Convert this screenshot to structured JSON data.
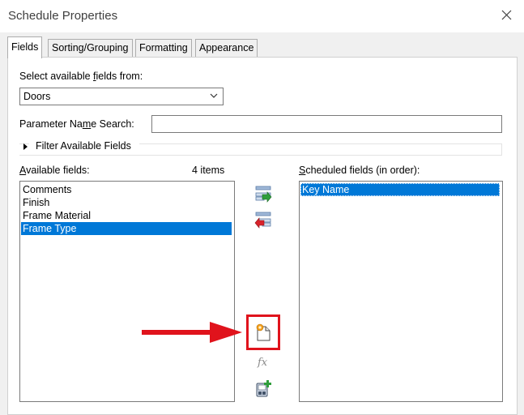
{
  "window": {
    "title": "Schedule Properties"
  },
  "tabs": [
    {
      "label": "Fields",
      "active": true
    },
    {
      "label": "Sorting/Grouping",
      "active": false
    },
    {
      "label": "Formatting",
      "active": false
    },
    {
      "label": "Appearance",
      "active": false
    }
  ],
  "fields_tab": {
    "select_label_pre": "Select available ",
    "select_label_acc": "f",
    "select_label_post": "ields from:",
    "category_value": "Doors",
    "search_label_pre": "Parameter Na",
    "search_label_acc": "m",
    "search_label_post": "e Search:",
    "search_value": "",
    "filter_label": "Filter Available Fields",
    "available_label_pre": "",
    "available_label_acc": "A",
    "available_label_post": "vailable fields:",
    "item_count": "4 items",
    "available_fields": [
      "Comments",
      "Finish",
      "Frame Material",
      "Frame Type"
    ],
    "available_selected": "Frame Type",
    "scheduled_label_acc": "S",
    "scheduled_label_post": "cheduled fields (in order):",
    "scheduled_fields": [
      "Key Name"
    ],
    "scheduled_selected": "Key Name",
    "formula_glyph": "fx"
  },
  "icons": {
    "close": "close-icon",
    "add_field": "add-field-icon",
    "remove_field": "remove-field-icon",
    "new_parameter": "new-parameter-icon",
    "calculated_value": "calculated-value-icon",
    "combine_parameters": "combine-parameters-icon"
  },
  "colors": {
    "selection": "#0078d7",
    "annotation_red": "#e0131c"
  }
}
